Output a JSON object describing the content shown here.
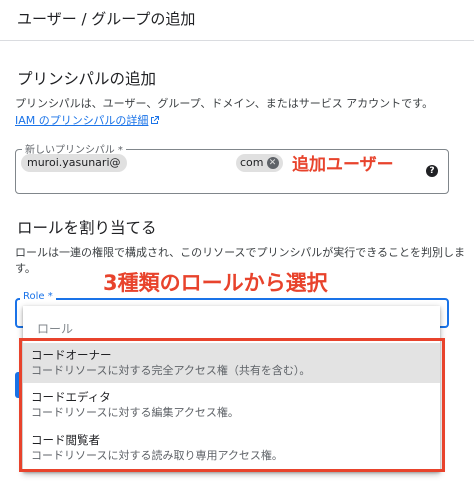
{
  "panel": {
    "title": "ユーザー / グループの追加"
  },
  "principals": {
    "title": "プリンシパルの追加",
    "description": "プリンシパルは、ユーザー、グループ、ドメイン、またはサービス アカウントです。",
    "link": "IAM のプリンシパルの詳細",
    "field_label": "新しいプリンシパル *",
    "chip_user": "muroi.yasunari@",
    "chip_domain": "com",
    "annotation": "追加ユーザー"
  },
  "roles": {
    "title": "ロールを割り当てる",
    "description": "ロールは一連の権限で構成され、このリソースでプリンシパルが実行できることを判別します。",
    "field_label": "Role *",
    "annotation": "3種類のロールから選択",
    "filter_placeholder": "ロール",
    "options": [
      {
        "name": "コードオーナー",
        "description": "コードリソースに対する完全アクセス権（共有を含む）。"
      },
      {
        "name": "コードエディタ",
        "description": "コードリソースに対する編集アクセス権。"
      },
      {
        "name": "コード閲覧者",
        "description": "コードリソースに対する読み取り専用アクセス権。"
      }
    ]
  },
  "colors": {
    "accent": "#1a73e8",
    "annotation": "#e8432c"
  }
}
